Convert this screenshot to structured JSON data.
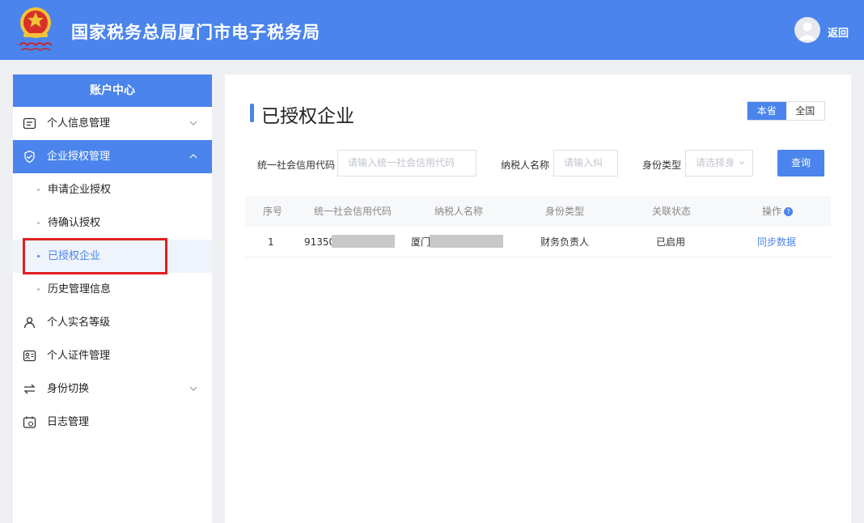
{
  "header": {
    "title": "国家税务总局厦门市电子税务局",
    "back_label": "返回",
    "accent": "#4a84ec"
  },
  "sidebar": {
    "title": "账户中心",
    "items": [
      {
        "label": "个人信息管理",
        "icon": "profile-card-icon"
      },
      {
        "label": "企业授权管理",
        "icon": "shield-check-icon"
      },
      {
        "label": "申请企业授权"
      },
      {
        "label": "待确认授权"
      },
      {
        "label": "已授权企业"
      },
      {
        "label": "历史管理信息"
      },
      {
        "label": "个人实名等级",
        "icon": "user-icon"
      },
      {
        "label": "个人证件管理",
        "icon": "id-card-icon"
      },
      {
        "label": "身份切换",
        "icon": "switch-icon"
      },
      {
        "label": "日志管理",
        "icon": "log-icon"
      }
    ]
  },
  "main": {
    "page_title": "已授权企业",
    "region": {
      "province": "本省",
      "national": "全国"
    },
    "filters": {
      "credit_code_label": "统一社会信用代码",
      "credit_code_placeholder": "请输入统一社会信用代码",
      "taxpayer_label": "纳税人名称",
      "taxpayer_placeholder": "请输入纠",
      "identity_label": "身份类型",
      "identity_placeholder": "请选择身",
      "query_label": "查询"
    },
    "table": {
      "columns": [
        "序号",
        "统一社会信用代码",
        "纳税人名称",
        "身份类型",
        "关联状态",
        "操作"
      ],
      "rows": [
        {
          "index": "1",
          "credit_code": "91350",
          "taxpayer": "厦门",
          "identity": "财务负责人",
          "status": "已启用",
          "action": "同步数据"
        }
      ]
    }
  }
}
